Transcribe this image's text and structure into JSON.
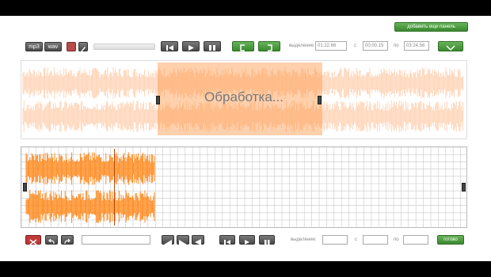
{
  "top": {
    "add_panel_label": "добавить еще панель",
    "format_mp3": "mp3",
    "format_wav": "wav",
    "selection_label": "выделение:",
    "selection_start": "01:22.66",
    "from_label": "с",
    "from_value": "00:00.15",
    "to_label": "по",
    "to_value": "03:24.56"
  },
  "panel1": {
    "overlay_text": "Обработка..."
  },
  "bottom": {
    "selection_label": "выделение:",
    "from_label": "с",
    "to_label": "по",
    "done_label": "готово"
  },
  "colors": {
    "accent_orange": "#ff8a1f",
    "faded_orange": "#ffd0b0",
    "green": "#3b8a2f",
    "grid_line": "#c8c8c8"
  },
  "icons": [
    "scissors-icon",
    "undo-icon",
    "redo-icon",
    "skip-back-icon",
    "play-icon",
    "pause-icon",
    "fade-in-icon",
    "fade-out-icon",
    "zoom-icon",
    "chevron-down-icon",
    "mark-start-icon",
    "mark-end-icon"
  ]
}
